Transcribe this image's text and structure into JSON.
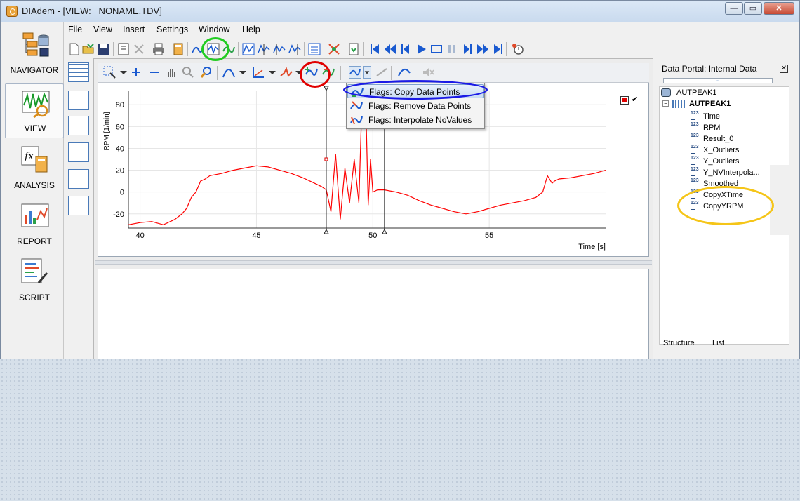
{
  "window": {
    "title": "DIAdem - [VIEW:   NONAME.TDV]",
    "buttons": {
      "minimize": "—",
      "maximize": "▭",
      "close": "✕"
    }
  },
  "menu": [
    "File",
    "View",
    "Insert",
    "Settings",
    "Window",
    "Help"
  ],
  "navigation": [
    {
      "label": "NAVIGATOR",
      "icon": "navigator-icon"
    },
    {
      "label": "VIEW",
      "icon": "view-icon"
    },
    {
      "label": "ANALYSIS",
      "icon": "analysis-icon"
    },
    {
      "label": "REPORT",
      "icon": "report-icon"
    },
    {
      "label": "SCRIPT",
      "icon": "script-icon"
    }
  ],
  "dropdown": {
    "items": [
      {
        "label": "Flags: Copy Data Points",
        "icon": "flag-copy-icon"
      },
      {
        "label": "Flags: Remove Data Points",
        "icon": "flag-remove-icon"
      },
      {
        "label": "Flags: Interpolate NoValues",
        "icon": "flag-interpolate-icon"
      }
    ]
  },
  "portal": {
    "title": "Data Portal: Internal Data",
    "root": "AUTPEAK1",
    "group": "AUTPEAK1",
    "channels": [
      "Time",
      "RPM",
      "Result_0",
      "X_Outliers",
      "Y_Outliers",
      "Y_NVInterpola...",
      "Smoothed",
      "CopyXTime",
      "CopyYRPM"
    ],
    "channel_type_badge": "123",
    "tabs": [
      "Structure",
      "List"
    ]
  },
  "colors": {
    "series": "#ff0000",
    "annotation_green": "#22cc22",
    "annotation_red": "#e00000",
    "annotation_blue": "#1a1ae6",
    "annotation_yellow": "#f5c518"
  },
  "chart_data": {
    "type": "line",
    "xlabel": "Time [s]",
    "ylabel": "RPM [1/min]",
    "xlim": [
      39.5,
      60
    ],
    "ylim": [
      -33,
      93
    ],
    "xticks": [
      40,
      45,
      50,
      55
    ],
    "yticks": [
      -20,
      0,
      20,
      40,
      60,
      80
    ],
    "cursors": [
      48.0,
      50.5
    ],
    "series": [
      {
        "x": [
          39.5,
          40.0,
          40.5,
          41.0,
          41.5,
          41.8,
          42.0,
          42.2,
          42.4,
          42.6,
          42.8,
          43.0,
          43.5,
          44.0,
          44.5,
          45.0,
          45.5,
          46.0,
          46.5,
          47.0,
          47.5,
          47.8,
          48.0,
          48.2,
          48.4,
          48.6,
          48.8,
          49.0,
          49.2,
          49.4,
          49.5,
          49.6,
          49.7,
          49.8,
          49.9,
          50.0,
          50.2,
          50.5,
          51.0,
          51.5,
          52.0,
          52.5,
          53.0,
          53.5,
          54.0,
          54.5,
          55.0,
          55.5,
          56.0,
          56.5,
          57.0,
          57.3,
          57.5,
          57.7,
          57.8,
          58.0,
          58.5,
          59.0,
          59.5,
          60.0
        ],
        "y": [
          -30,
          -28,
          -27,
          -30,
          -25,
          -20,
          -15,
          -5,
          0,
          10,
          12,
          15,
          17,
          20,
          22,
          24,
          23,
          20,
          17,
          13,
          8,
          5,
          2,
          -18,
          35,
          -25,
          22,
          -10,
          30,
          -10,
          60,
          85,
          80,
          -12,
          30,
          0,
          2,
          2,
          0,
          -3,
          -8,
          -12,
          -15,
          -18,
          -20,
          -18,
          -15,
          -12,
          -10,
          -8,
          -5,
          0,
          15,
          8,
          10,
          12,
          13,
          15,
          17,
          20
        ]
      }
    ]
  }
}
